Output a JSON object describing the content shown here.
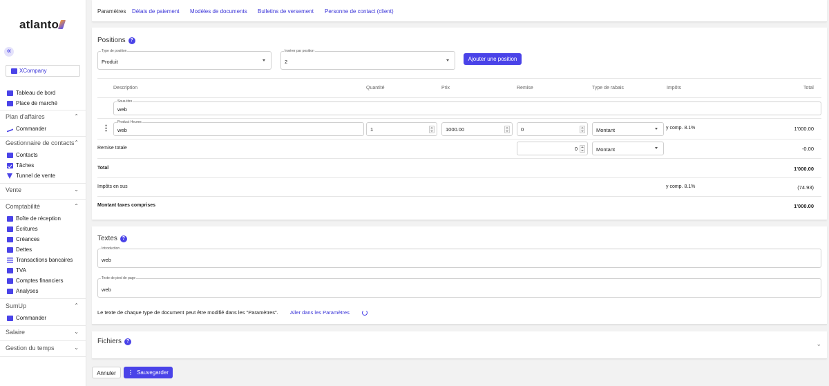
{
  "app": {
    "logo_text": "atlanto",
    "collapse_icon": "«",
    "brand_color": "#4a43e8"
  },
  "company": {
    "name": "XCompany"
  },
  "sidebar": {
    "top_items": [
      {
        "label": "Tableau de bord",
        "icon": "dashboard-icon"
      },
      {
        "label": "Place de marché",
        "icon": "store-icon"
      }
    ],
    "sections": [
      {
        "title": "Plan d'affaires",
        "chev": "⌃",
        "items": [
          {
            "label": "Commander",
            "icon": "chart-icon"
          }
        ]
      },
      {
        "title": "Gestionnaire de contacts",
        "chev": "⌃",
        "items": [
          {
            "label": "Contacts",
            "icon": "contacts-icon"
          },
          {
            "label": "Tâches",
            "icon": "check-icon"
          },
          {
            "label": "Tunnel de vente",
            "icon": "funnel-icon"
          }
        ]
      },
      {
        "title": "Vente",
        "chev": "⌄",
        "items": []
      },
      {
        "title": "Comptabilité",
        "chev": "⌃",
        "items": [
          {
            "label": "Boîte de réception",
            "icon": "inbox-icon"
          },
          {
            "label": "Écritures",
            "icon": "book-icon"
          },
          {
            "label": "Créances",
            "icon": "receivable-icon"
          },
          {
            "label": "Dettes",
            "icon": "debt-icon"
          },
          {
            "label": "Transactions bancaires",
            "icon": "bank-icon"
          },
          {
            "label": "TVA",
            "icon": "vat-icon"
          },
          {
            "label": "Comptes financiers",
            "icon": "accounts-icon"
          },
          {
            "label": "Analyses",
            "icon": "analytics-icon"
          }
        ]
      },
      {
        "title": "SumUp",
        "chev": "⌃",
        "items": [
          {
            "label": "Commander",
            "icon": "cart-icon"
          }
        ]
      },
      {
        "title": "Salaire",
        "chev": "⌄",
        "items": []
      },
      {
        "title": "Gestion du temps",
        "chev": "⌄",
        "items": []
      }
    ]
  },
  "params": {
    "label": "Paramètres",
    "links": [
      "Délais de paiement",
      "Modèles de documents",
      "Bulletins de versement",
      "Personne de contact (client)"
    ]
  },
  "positions": {
    "title": "Positions",
    "help": "?",
    "type_label": "Type de position",
    "type_value": "Produit",
    "insert_label": "Insérer par position",
    "insert_value": "2",
    "add_button": "Ajouter une position",
    "headers": {
      "description": "Description",
      "quantity": "Quantité",
      "price": "Prix",
      "discount": "Remise",
      "discount_type": "Type de rabais",
      "taxes": "Impôts",
      "total": "Total"
    },
    "subtitle_label": "Sous-titre",
    "subtitle_value": "web",
    "row": {
      "desc_label": "Product Heures",
      "desc_value": "web",
      "quantity": "1",
      "price": "1000.00",
      "discount": "0",
      "discount_type": "Montant",
      "taxes": "y comp. 8.1%",
      "total": "1'000.00"
    },
    "total_discount": {
      "label": "Remise totale",
      "value": "0",
      "type": "Montant",
      "total": "-0.00"
    },
    "total": {
      "label": "Total",
      "value": "1'000.00"
    },
    "tax": {
      "label": "Impôts en sus",
      "rate": "y comp. 8.1%",
      "value": "(74.93)"
    },
    "grand": {
      "label": "Montant taxes comprises",
      "value": "1'000.00"
    }
  },
  "texts": {
    "title": "Textes",
    "help": "?",
    "intro_label": "Introduction",
    "intro_value": "web",
    "footer_label": "Texte de pied de page",
    "footer_value": "web",
    "note": "Le texte de chaque type de document peut être modifié dans les \"Paramètres\".",
    "note_link": "Aller dans les Paramètres"
  },
  "files": {
    "title": "Fichiers",
    "help": "?",
    "chev": "⌄"
  },
  "footer": {
    "cancel": "Annuler",
    "save": "Sauvegarder"
  }
}
